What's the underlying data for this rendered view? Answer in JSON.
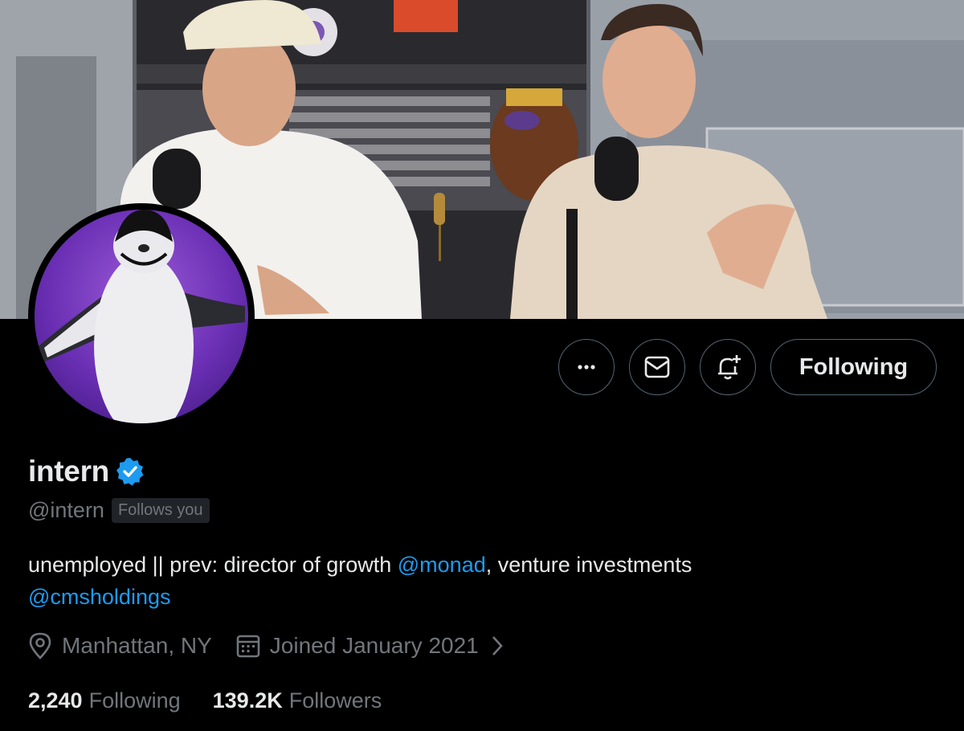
{
  "banner": {
    "image_desc": "banner-photo"
  },
  "avatar": {
    "image_desc": "avatar-penguin"
  },
  "actions": {
    "more_icon": "more-icon",
    "message_icon": "mail-icon",
    "notify_icon": "bell-plus-icon",
    "following_label": "Following"
  },
  "profile": {
    "name": "intern",
    "handle": "@intern",
    "follows_you": "Follows you",
    "bio_text_1": "unemployed || prev: director of growth ",
    "bio_mention_1": "@monad",
    "bio_text_2": ", venture investments",
    "bio_mention_2": "@cmsholdings",
    "location": "Manhattan, NY",
    "joined": "Joined January 2021"
  },
  "stats": {
    "following_count": "2,240",
    "following_label": "Following",
    "followers_count": "139.2K",
    "followers_label": "Followers"
  },
  "colors": {
    "accent": "#1d9bf0",
    "muted": "#71767b",
    "text": "#e7e9ea",
    "border": "#536471"
  }
}
